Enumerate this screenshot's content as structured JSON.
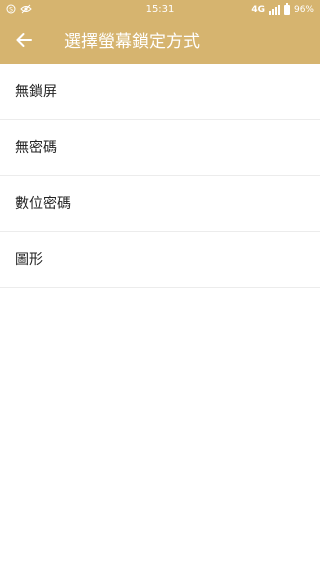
{
  "status_bar": {
    "time": "15:31",
    "network": "4G",
    "battery": "96%",
    "battery_level": 0.96,
    "left_icons": [
      "sync-icon",
      "eye-off-icon"
    ]
  },
  "toolbar": {
    "back_icon": "arrow-left-icon",
    "title": "選擇螢幕鎖定方式"
  },
  "options": [
    {
      "label": "無鎖屏"
    },
    {
      "label": "無密碼"
    },
    {
      "label": "數位密碼"
    },
    {
      "label": "圖形"
    }
  ],
  "colors": {
    "accent": "#d6b46f",
    "background": "#ffffff",
    "text": "#222222",
    "divider": "#ececec"
  }
}
